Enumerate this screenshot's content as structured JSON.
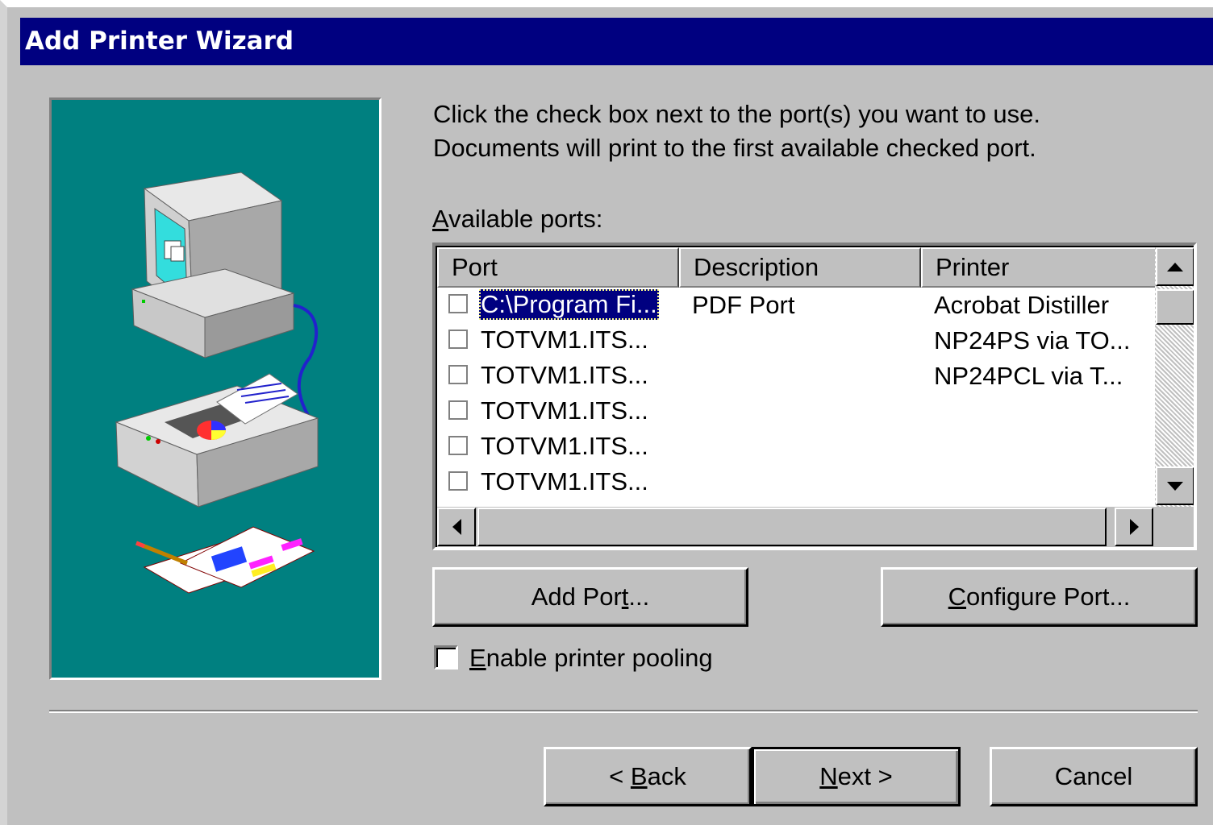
{
  "window": {
    "title": "Add Printer Wizard"
  },
  "instructions": {
    "line1": "Click the check box next to the port(s) you want to use.",
    "line2": "Documents will print to the first available checked port."
  },
  "ports_label": {
    "mnemonic": "A",
    "rest": "vailable ports:"
  },
  "ports_table": {
    "columns": [
      "Port",
      "Description",
      "Printer"
    ],
    "rows": [
      {
        "port": "C:\\Program Fi...",
        "description": "PDF Port",
        "printer": "Acrobat Distiller",
        "checked": false,
        "selected": true
      },
      {
        "port": "TOTVM1.ITS...",
        "description": "",
        "printer": "NP24PS via TO...",
        "checked": false,
        "selected": false
      },
      {
        "port": "TOTVM1.ITS...",
        "description": "",
        "printer": "NP24PCL via T...",
        "checked": false,
        "selected": false
      },
      {
        "port": "TOTVM1.ITS...",
        "description": "",
        "printer": "",
        "checked": false,
        "selected": false
      },
      {
        "port": "TOTVM1.ITS...",
        "description": "",
        "printer": "",
        "checked": false,
        "selected": false
      },
      {
        "port": "TOTVM1.ITS...",
        "description": "",
        "printer": "",
        "checked": false,
        "selected": false
      }
    ]
  },
  "buttons": {
    "add_port": {
      "pre": "Add Por",
      "mnemonic": "t",
      "post": "..."
    },
    "configure_port": {
      "pre": "",
      "mnemonic": "C",
      "post": "onfigure Port..."
    },
    "back": {
      "pre": "< ",
      "mnemonic": "B",
      "post": "ack"
    },
    "next": {
      "pre": "",
      "mnemonic": "N",
      "post": "ext >"
    },
    "cancel": "Cancel"
  },
  "pooling": {
    "mnemonic": "E",
    "rest": "nable printer pooling",
    "checked": false
  },
  "icons": {
    "illustration": "computer-printer-documents-illustration",
    "scroll_up": "arrow-up-icon",
    "scroll_down": "arrow-down-icon",
    "scroll_left": "arrow-left-icon",
    "scroll_right": "arrow-right-icon"
  },
  "colors": {
    "titlebar": "#000080",
    "panel": "#c0c0c0",
    "illustration_bg": "#008080",
    "selection": "#000080"
  }
}
